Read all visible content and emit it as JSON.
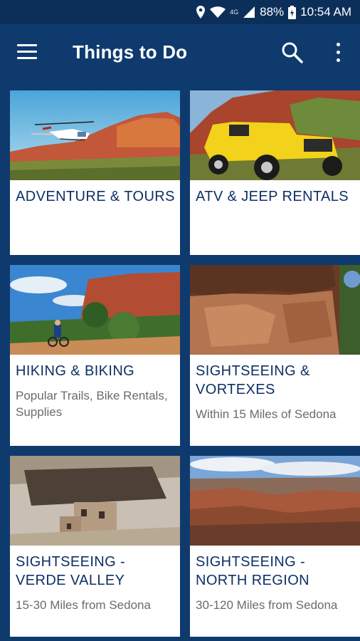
{
  "status_bar": {
    "battery": "88%",
    "time": "10:54 AM",
    "network": "4G",
    "icons": [
      "location-icon",
      "wifi-icon",
      "signal-icon",
      "battery-icon"
    ]
  },
  "app_bar": {
    "title": "Things to Do",
    "icons": [
      "menu-icon",
      "search-icon",
      "more-vert-icon"
    ]
  },
  "colors": {
    "primary": "#0f3a6e",
    "status_bar": "#0c2f5a",
    "card_title": "#0d3064",
    "card_subtitle": "#6b6b6b"
  },
  "cards": [
    {
      "title": "ADVENTURE & TOURS",
      "subtitle": "",
      "image": "helicopter-red-rocks"
    },
    {
      "title": "ATV & JEEP RENTALS",
      "subtitle": "",
      "image": "yellow-jeep"
    },
    {
      "title": "HIKING & BIKING",
      "subtitle": "Popular Trails, Bike Rentals, Supplies",
      "image": "mountain-biker-trail"
    },
    {
      "title": "SIGHTSEEING & VORTEXES",
      "subtitle": "Within 15 Miles of Sedona",
      "image": "red-rock-cliff-dwelling"
    },
    {
      "title": "SIGHTSEEING - VERDE VALLEY",
      "subtitle": "15-30 Miles from Sedona",
      "image": "montezuma-castle"
    },
    {
      "title": "SIGHTSEEING - NORTH REGION",
      "subtitle": "30-120 Miles from Sedona",
      "image": "grand-canyon"
    }
  ]
}
